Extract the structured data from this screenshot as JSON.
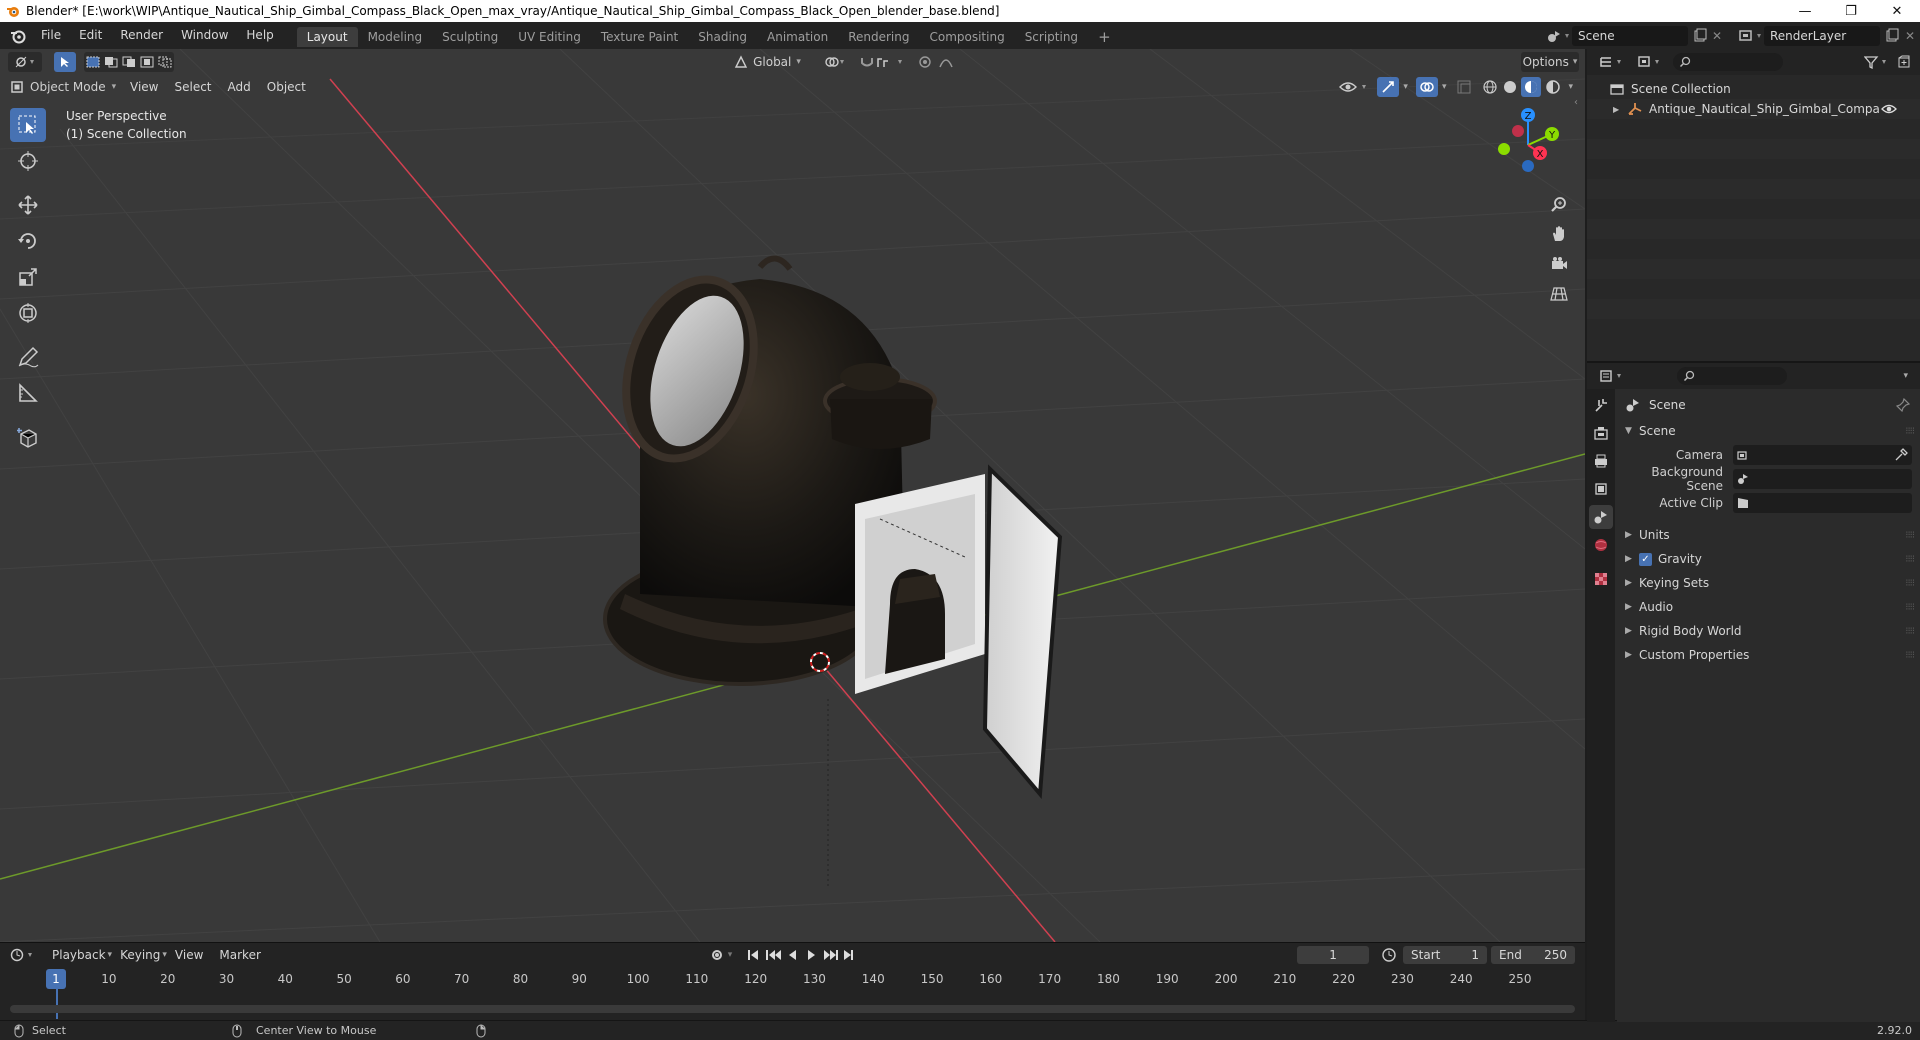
{
  "window": {
    "title": "Blender* [E:\\work\\WIP\\Antique_Nautical_Ship_Gimbal_Compass_Black_Open_max_vray/Antique_Nautical_Ship_Gimbal_Compass_Black_Open_blender_base.blend]",
    "minimize": "—",
    "restore": "❐",
    "close": "✕"
  },
  "menus": [
    "File",
    "Edit",
    "Render",
    "Window",
    "Help"
  ],
  "workspaces": [
    "Layout",
    "Modeling",
    "Sculpting",
    "UV Editing",
    "Texture Paint",
    "Shading",
    "Animation",
    "Rendering",
    "Compositing",
    "Scripting"
  ],
  "add_workspace": "+",
  "scene_selector": {
    "value": "Scene"
  },
  "render_layer": {
    "value": "RenderLayer"
  },
  "viewport": {
    "mode": "Object Mode",
    "menu": [
      "View",
      "Select",
      "Add",
      "Object"
    ],
    "transform_orientation": "Global",
    "options": "Options",
    "perspective_label": "User Perspective",
    "collection_label": "(1) Scene Collection",
    "gizmo": {
      "x": "X",
      "y": "Y",
      "z": "Z"
    }
  },
  "timeline": {
    "menus": [
      "Playback",
      "Keying",
      "View",
      "Marker"
    ],
    "current_frame": "1",
    "start_label": "Start",
    "start_value": "1",
    "end_label": "End",
    "end_value": "250",
    "ticks": [
      "1",
      "10",
      "20",
      "30",
      "40",
      "50",
      "60",
      "70",
      "80",
      "90",
      "100",
      "110",
      "120",
      "130",
      "140",
      "150",
      "160",
      "170",
      "180",
      "190",
      "200",
      "210",
      "220",
      "230",
      "240",
      "250"
    ]
  },
  "statusbar": {
    "select": "Select",
    "center_view": "Center View to Mouse",
    "version": "2.92.0"
  },
  "outliner": {
    "root": "Scene Collection",
    "items": [
      {
        "label": "Antique_Nautical_Ship_Gimbal_Compass_Bl..."
      }
    ]
  },
  "properties": {
    "context": "Scene",
    "panel_title": "Scene",
    "fields": [
      {
        "label": "Camera"
      },
      {
        "label": "Background Scene"
      },
      {
        "label": "Active Clip"
      }
    ],
    "panels": [
      "Units",
      "Gravity",
      "Keying Sets",
      "Audio",
      "Rigid Body World",
      "Custom Properties"
    ],
    "gravity_checked": true
  },
  "colors": {
    "accent": "#4772b3",
    "axis_x": "#ff3352",
    "axis_y": "#8bdc00",
    "axis_z": "#2890ff"
  }
}
